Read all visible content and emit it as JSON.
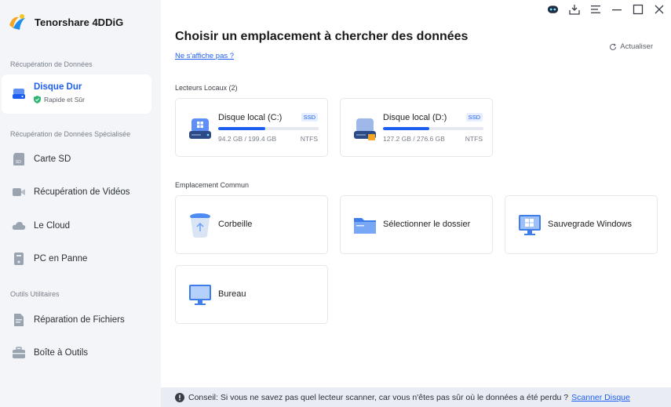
{
  "app": {
    "name": "Tenorshare 4DDiG"
  },
  "sidebar": {
    "sections": [
      {
        "label": "Récupération de Données"
      },
      {
        "label": "Récupération de Données Spécialisée"
      },
      {
        "label": "Outils Utilitaires"
      }
    ],
    "items": [
      {
        "label": "Disque Dur",
        "sub": "Rapide et Sûr",
        "icon": "hard-drive-icon"
      },
      {
        "label": "Carte SD",
        "icon": "sd-card-icon"
      },
      {
        "label": "Récupération de Vidéos",
        "icon": "video-camera-icon"
      },
      {
        "label": "Le Cloud",
        "icon": "cloud-icon"
      },
      {
        "label": "PC en Panne",
        "icon": "crashed-pc-icon"
      },
      {
        "label": "Réparation de Fichiers",
        "icon": "file-repair-icon"
      },
      {
        "label": "Boîte à Outils",
        "icon": "toolbox-icon"
      }
    ]
  },
  "main": {
    "title": "Choisir un emplacement à chercher des données",
    "help_link": "Ne s'affiche pas ?",
    "refresh_label": "Actualiser",
    "local_drives_label": "Lecteurs Locaux (2)",
    "drives": [
      {
        "name": "Disque local (C:)",
        "badge": "SSD",
        "size": "94.2 GB / 199.4 GB",
        "fs": "NTFS",
        "used_fraction": 0.472
      },
      {
        "name": "Disque local (D:)",
        "badge": "SSD",
        "size": "127.2 GB / 276.6 GB",
        "fs": "NTFS",
        "used_fraction": 0.46
      }
    ],
    "common_label": "Emplacement Commun",
    "locations": [
      {
        "label": "Corbeille",
        "icon": "recycle-bin-icon"
      },
      {
        "label": "Sélectionner le dossier",
        "icon": "folder-icon"
      },
      {
        "label": "Sauvegrade Windows",
        "icon": "windows-backup-icon"
      },
      {
        "label": "Bureau",
        "icon": "desktop-icon"
      }
    ]
  },
  "footer": {
    "tip": "Conseil: Si vous ne savez pas quel lecteur scanner, car vous n'êtes pas sûr où le données a été perdu ?",
    "link": "Scanner Disque"
  },
  "colors": {
    "accent": "#1d5ef0",
    "sidebar_bg": "#f3f5f8",
    "footer_bg": "#e9edf3"
  }
}
